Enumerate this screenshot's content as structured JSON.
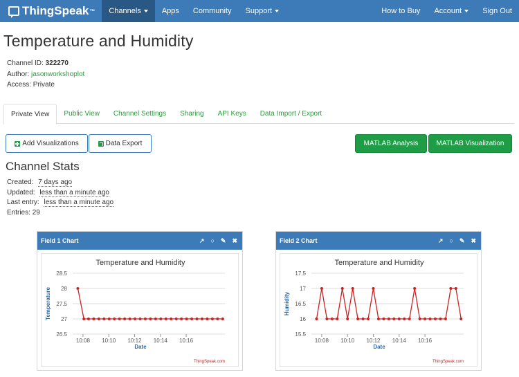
{
  "nav": {
    "brand": "ThingSpeak",
    "trademark": "™",
    "channels": "Channels",
    "apps": "Apps",
    "community": "Community",
    "support": "Support",
    "how_to_buy": "How to Buy",
    "account": "Account",
    "sign_out": "Sign Out"
  },
  "page": {
    "title": "Temperature and Humidity",
    "channel_id_label": "Channel ID:",
    "channel_id": "322270",
    "author_label": "Author:",
    "author": "jasonworkshoplot",
    "access_label": "Access:",
    "access": "Private"
  },
  "tabs": [
    "Private View",
    "Public View",
    "Channel Settings",
    "Sharing",
    "API Keys",
    "Data Import / Export"
  ],
  "buttons": {
    "add_visualizations": "Add Visualizations",
    "data_export": "Data Export",
    "matlab_analysis": "MATLAB Analysis",
    "matlab_visualization": "MATLAB Visualization"
  },
  "stats": {
    "title": "Channel Stats",
    "created_label": "Created:",
    "created": "7 days ago",
    "updated_label": "Updated:",
    "updated": "less than a minute ago",
    "last_entry_label": "Last entry:",
    "last_entry": "less than a minute ago",
    "entries_label": "Entries:",
    "entries": "29"
  },
  "colors": {
    "nav": "#3d7ab8",
    "nav_active": "#2a5885",
    "green": "#1e9c46",
    "link": "#2e9a3e",
    "series": "#cc2222"
  },
  "widgets": [
    {
      "header": "Field 1 Chart",
      "icons": [
        "external-link-icon",
        "comment-icon",
        "pencil-icon",
        "close-icon"
      ]
    },
    {
      "header": "Field 2 Chart",
      "icons": [
        "external-link-icon",
        "comment-icon",
        "pencil-icon",
        "close-icon"
      ]
    }
  ],
  "chart_data": [
    {
      "type": "line",
      "title": "Temperature and Humidity",
      "xlabel": "Date",
      "ylabel": "Temperature",
      "credits": "ThingSpeak.com",
      "ylim": [
        26.5,
        28.5
      ],
      "yticks": [
        "28.5",
        "28",
        "27.5",
        "27",
        "26.5"
      ],
      "xticks": [
        "10:08",
        "10:10",
        "10:12",
        "10:14",
        "10:16"
      ],
      "xtick_minutes": [
        8,
        10,
        12,
        14,
        16
      ],
      "x_minutes": [
        7.6,
        8.07,
        8.43,
        8.83,
        9.23,
        9.63,
        10.03,
        10.43,
        10.83,
        11.23,
        11.63,
        12.03,
        12.43,
        12.83,
        13.23,
        13.63,
        14.03,
        14.43,
        14.83,
        15.23,
        15.63,
        16.03,
        16.43,
        16.83,
        17.23,
        17.63,
        18.03,
        18.43,
        18.83
      ],
      "values": [
        28,
        27,
        27,
        27,
        27,
        27,
        27,
        27,
        27,
        27,
        27,
        27,
        27,
        27,
        27,
        27,
        27,
        27,
        27,
        27,
        27,
        27,
        27,
        27,
        27,
        27,
        27,
        27,
        27
      ],
      "series_color": "#cc2222"
    },
    {
      "type": "line",
      "title": "Temperature and Humidity",
      "xlabel": "Date",
      "ylabel": "Humidity",
      "credits": "ThingSpeak.com",
      "ylim": [
        15.5,
        17.5
      ],
      "yticks": [
        "17.5",
        "17",
        "16.5",
        "16",
        "15.5"
      ],
      "xticks": [
        "10:08",
        "10:10",
        "10:12",
        "10:14",
        "10:16"
      ],
      "xtick_minutes": [
        8,
        10,
        12,
        14,
        16
      ],
      "x_minutes": [
        7.6,
        8.0,
        8.4,
        8.8,
        9.2,
        9.6,
        10.0,
        10.4,
        10.8,
        11.2,
        11.6,
        12.0,
        12.4,
        12.8,
        13.2,
        13.6,
        14.0,
        14.4,
        14.8,
        15.2,
        15.6,
        16.0,
        16.4,
        16.8,
        17.2,
        17.6,
        18.0,
        18.4,
        18.8
      ],
      "values": [
        16,
        17,
        16,
        16,
        16,
        17,
        16,
        17,
        16,
        16,
        16,
        17,
        16,
        16,
        16,
        16,
        16,
        16,
        16,
        17,
        16,
        16,
        16,
        16,
        16,
        16,
        17,
        17,
        16
      ],
      "series_color": "#cc2222"
    }
  ]
}
